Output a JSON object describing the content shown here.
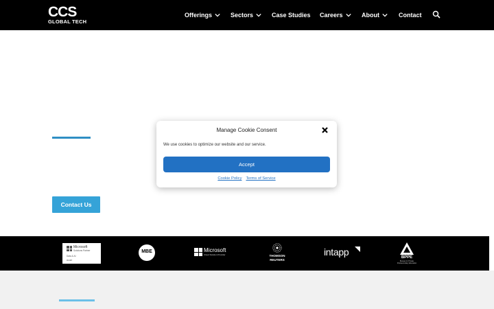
{
  "header": {
    "logo": {
      "top": "CCS",
      "bottom": "GLOBAL TECH"
    },
    "nav": [
      {
        "label": "Offerings",
        "has_dropdown": true
      },
      {
        "label": "Sectors",
        "has_dropdown": true
      },
      {
        "label": "Case Studies",
        "has_dropdown": false
      },
      {
        "label": "Careers",
        "has_dropdown": true
      },
      {
        "label": "About",
        "has_dropdown": true
      },
      {
        "label": "Contact",
        "has_dropdown": false
      }
    ],
    "search_icon": "search-icon"
  },
  "hero": {
    "contact_button": "Contact Us",
    "accent_color": "#2f8fc4"
  },
  "cookie_modal": {
    "title": "Manage Cookie Consent",
    "message": "We use cookies to optimize our website and our service.",
    "accept_label": "Accept",
    "links": [
      "Cookie Policy",
      "Terms of Service"
    ],
    "close_icon": "close-icon",
    "button_color": "#2271c3"
  },
  "partners": {
    "microsoft_card": {
      "name": "Microsoft",
      "line1": "Solutions Partner",
      "line2": "Data & AI",
      "line3": "Azure"
    },
    "mbe": "MBE",
    "microsoft_logo": {
      "name": "Microsoft",
      "tagline": "Cloud Solution Provider"
    },
    "thomson": {
      "line1": "THOMSON",
      "line2": "REUTERS"
    },
    "intapp": "intapp",
    "bppe": {
      "name": "BPPE",
      "tagline": "Bureau for Private Postsecondary Education"
    }
  },
  "colors": {
    "header_bg": "#000000",
    "contact_button_bg": "#35a3d8",
    "lower_section_bg": "#f1f1f1"
  }
}
